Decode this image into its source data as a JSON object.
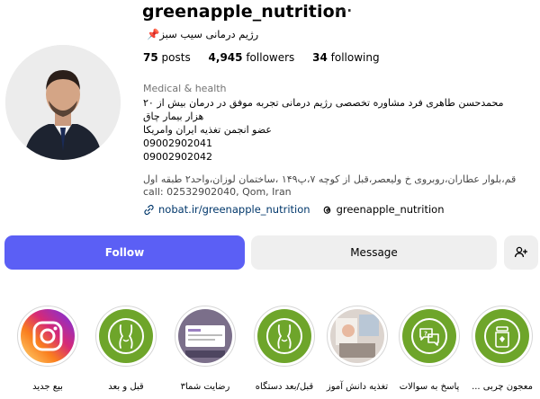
{
  "profile": {
    "username": "greenapple_nutrition",
    "more_glyph": "···",
    "fullname": "رژیم درمانی سیب سبز",
    "pin_glyph": "📌",
    "stats": {
      "posts_count": "75",
      "posts_label": "posts",
      "followers_count": "4,945",
      "followers_label": "followers",
      "following_count": "34",
      "following_label": "following"
    },
    "category": "Medical & health",
    "bio": {
      "line1": "محمدحسن طاهری فرد مشاوره تخصصی رژیم درمانی تجربه موفق در درمان بیش از ۲۰",
      "line2": "هزار بیمار چاق",
      "line3": "عضو انجمن تغذیه ایران وامریکا",
      "phone1": "09002902041",
      "phone2": "09002902042"
    },
    "address": {
      "line1": "قم،بلوار عطاران،روبروی خ ولیعصر،قبل از کوچه ۷،پ۱۴۹ ،ساختمان لوزان،واحد۲ طبقه اول",
      "line2": "call: 02532902040, Qom, Iran"
    },
    "link": "nobat.ir/greenapple_nutrition",
    "threads_handle": "greenapple_nutrition"
  },
  "actions": {
    "follow_label": "Follow",
    "message_label": "Message",
    "add_user_icon": "add-person-icon"
  },
  "highlights": [
    {
      "label": "معجون چربی ...",
      "icon": "jar-icon"
    },
    {
      "label": "پاسخ به سوالات",
      "icon": "chat-bubbles-icon"
    },
    {
      "label": "تغذیه دانش آموز",
      "icon": "photo-thumbnail"
    },
    {
      "label": "قبل/بعد دستگاه",
      "icon": "body-silhouette-icon"
    },
    {
      "label": "رضایت شما۳",
      "icon": "screenshot-thumbnail"
    },
    {
      "label": "قبل و بعد",
      "icon": "body-silhouette-icon"
    },
    {
      "label": "بیع جدید",
      "icon": "instagram-icon"
    }
  ],
  "colors": {
    "follow_button": "#5b5ff5",
    "secondary_button": "#efefef",
    "link": "#00376b",
    "highlight_green": "#6ea52a"
  }
}
